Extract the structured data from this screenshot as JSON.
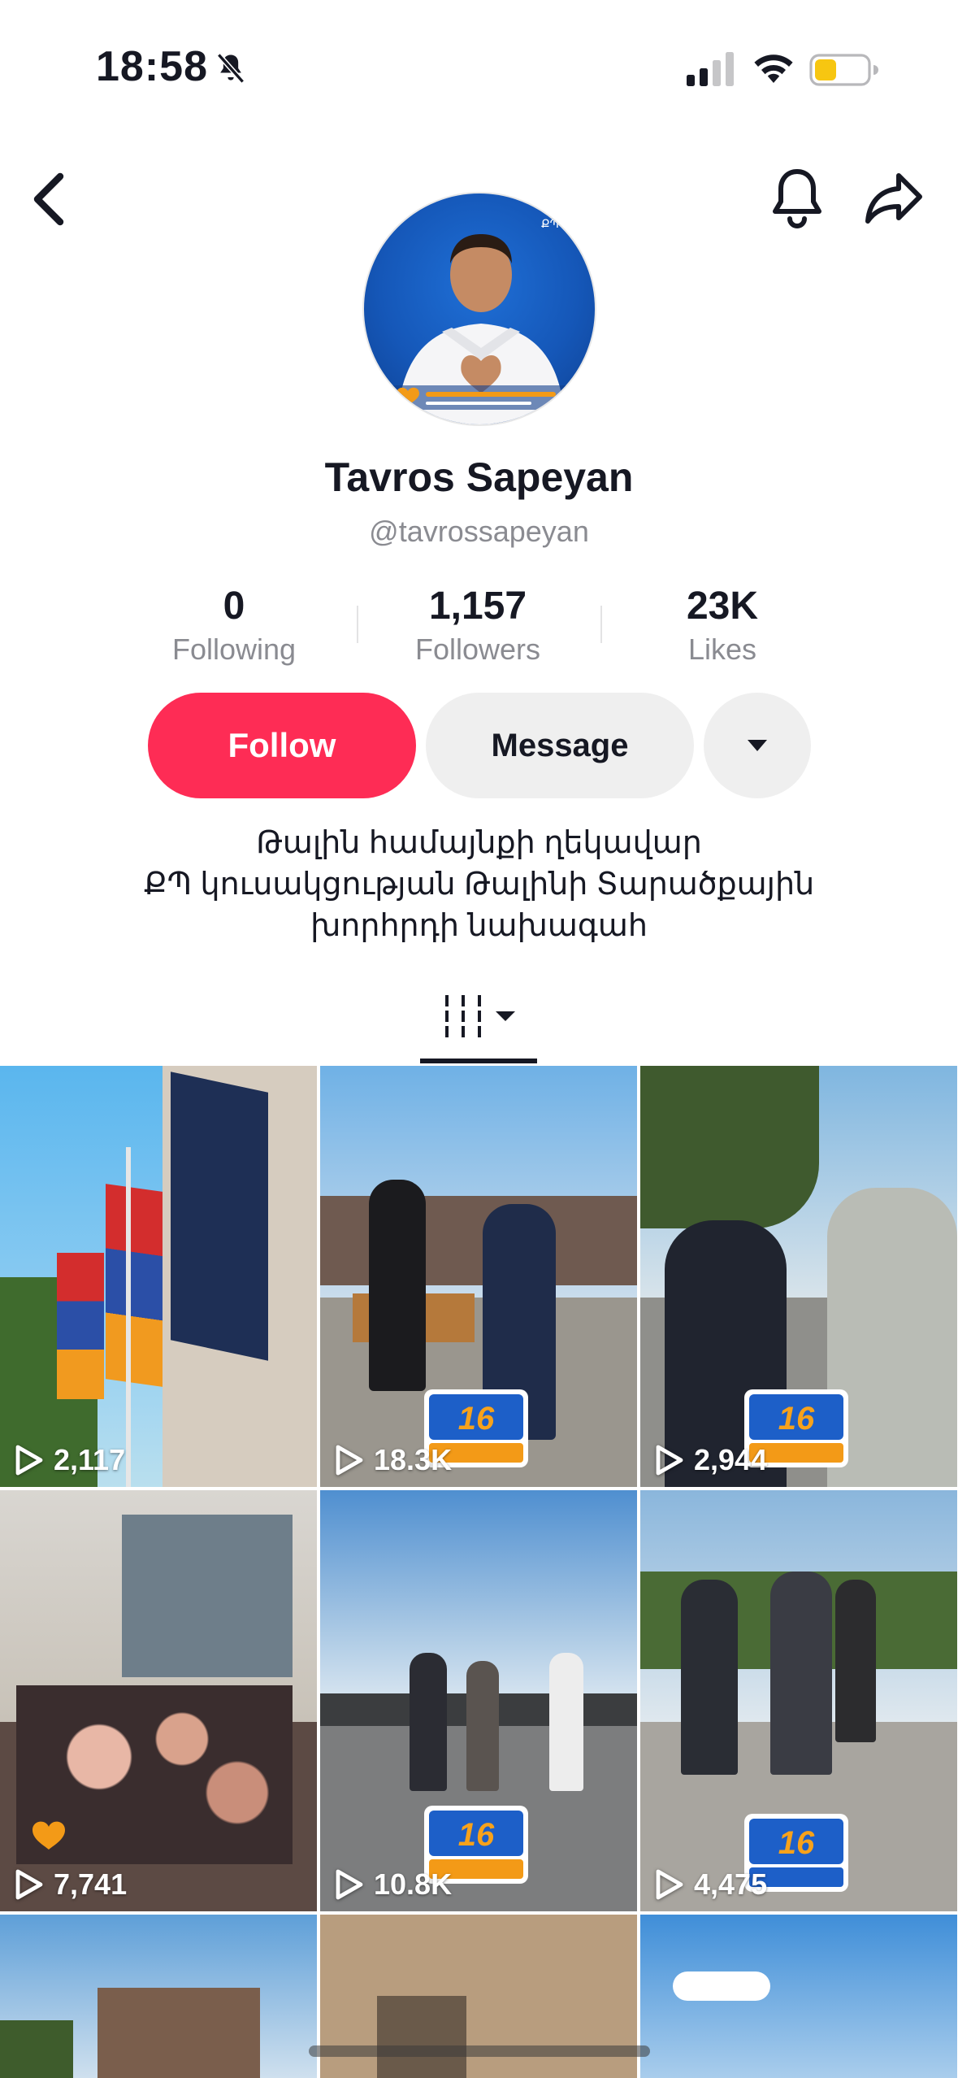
{
  "status_bar": {
    "time": "18:58",
    "icons": [
      "bell-slash-icon",
      "cellular-signal-icon",
      "wifi-icon",
      "battery-icon"
    ],
    "battery_color": "#f7c611"
  },
  "nav": {
    "icons": [
      "back-chevron-icon",
      "notification-bell-icon",
      "share-arrow-icon"
    ]
  },
  "profile": {
    "name": "Tavros Sapeyan",
    "handle": "@tavrossapeyan",
    "stats": [
      {
        "value": "0",
        "label": "Following"
      },
      {
        "value": "1,157",
        "label": "Followers"
      },
      {
        "value": "23K",
        "label": "Likes"
      }
    ],
    "follow_label": "Follow",
    "message_label": "Message",
    "bio_lines": [
      "Թալին համայնքի ղեկավար",
      "ՔՊ կուսակցության Թալինի Տարածքային",
      "խորհրդի նախագահ"
    ]
  },
  "tabs": {
    "active_icon": "video-grid-icon"
  },
  "videos": [
    {
      "views": "2,117"
    },
    {
      "views": "18.3K"
    },
    {
      "views": "2,944"
    },
    {
      "views": "7,741"
    },
    {
      "views": "10.8K"
    },
    {
      "views": "4,475"
    },
    {
      "views": ""
    },
    {
      "views": ""
    },
    {
      "views": ""
    }
  ],
  "colors": {
    "accent": "#fe2c55",
    "secondary_button": "#efefef",
    "muted_text": "#8a8b91"
  }
}
